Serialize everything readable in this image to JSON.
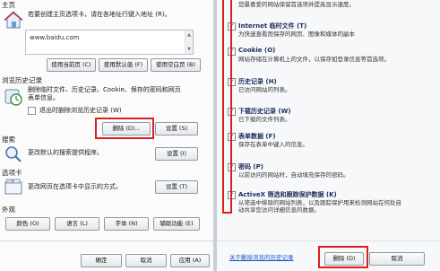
{
  "internet_options": {
    "home": {
      "title": "主页",
      "description": "若要创建主页选项卡，请在各地址行键入地址 (R)。",
      "url": "www.baidu.com",
      "buttons": [
        "使用当前页 (C)",
        "使用默认值 (F)",
        "使用空白页 (B)"
      ]
    },
    "history": {
      "title": "浏览历史记录",
      "description_line1": "删除临时文件、历史记录、Cookie、保存的密码和网页",
      "description_line2": "表单信息。",
      "checkbox_label": "退出时删除浏览历史记录 (W)",
      "delete_button": "删除 (D)...",
      "settings_button": "设置 (S)"
    },
    "search": {
      "title": "搜索",
      "description": "更改默认的搜索提供程序。",
      "settings_button": "设置 (I)"
    },
    "tabs": {
      "title": "选项卡",
      "description": "更改网页在选项卡中显示的方式。",
      "settings_button": "设置 (T)"
    },
    "appearance": {
      "title": "外观",
      "buttons": [
        "颜色 (O)",
        "语言 (L)",
        "字体 (N)",
        "辅助功能 (E)"
      ]
    },
    "footer_buttons": [
      "确定",
      "取消",
      "应用 (A)"
    ]
  },
  "delete_history": {
    "top_text": "您最喜爱的网站保留首选项并提高显示速度。",
    "options": [
      {
        "title": "Internet 临时文件 (T)",
        "desc": [
          "为快速查看而保存的网页、图像和媒体的副本"
        ],
        "checked": true
      },
      {
        "title": "Cookie (O)",
        "desc": [
          "网站存储在计算机上的文件，以保存如登录信息等首选项。"
        ],
        "checked": true
      },
      {
        "title": "历史记录 (H)",
        "desc": [
          "已访问网站的列表。"
        ],
        "checked": true
      },
      {
        "title": "下载历史记录 (W)",
        "desc": [
          "已下载的文件列表。"
        ],
        "checked": true
      },
      {
        "title": "表单数据 (F)",
        "desc": [
          "保存在表单中键入的信息。"
        ],
        "checked": true
      },
      {
        "title": "密码 (P)",
        "desc": [
          "以前访问的网站时，自动填充保存的密码。"
        ],
        "checked": true
      },
      {
        "title": "ActiveX 筛选和跟踪保护数据 (K)",
        "desc": [
          "从筛选中排除的网站列表，以及跟踪保护用来检测网站在何处自",
          "动共享您访问详细信息的数据。"
        ],
        "checked": true
      }
    ],
    "about_link": "关于删除浏览的历史记录",
    "delete_button": "删除 (D)",
    "cancel_button": "取消"
  },
  "colors": {
    "highlight": "#d82020",
    "link": "#1a56c7"
  }
}
